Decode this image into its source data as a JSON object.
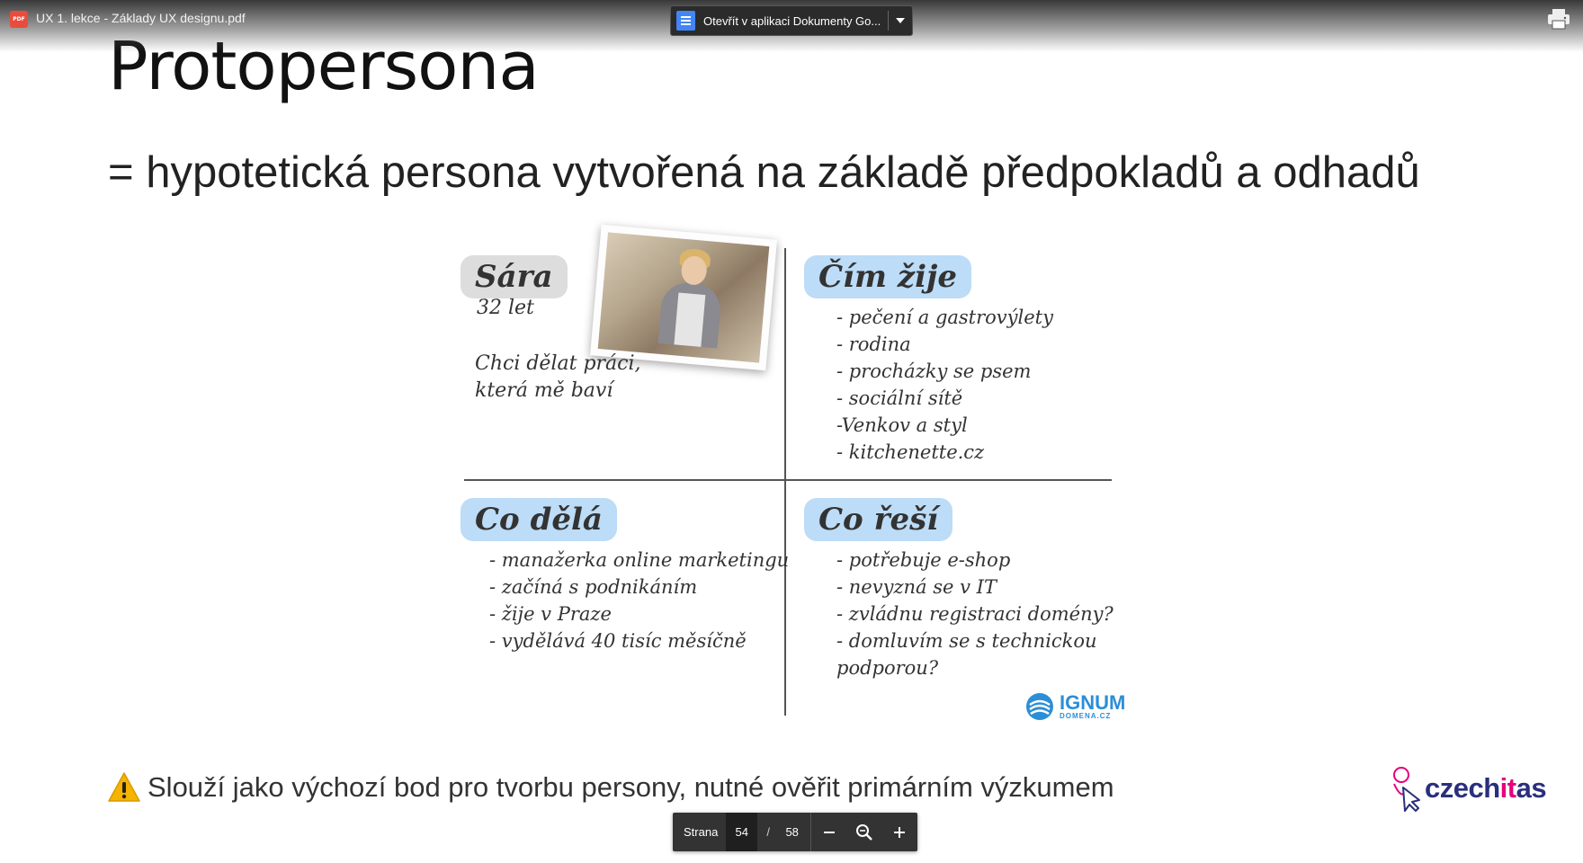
{
  "viewer": {
    "file_title": "UX 1. lekce - Základy UX designu.pdf",
    "file_badge": "PDF",
    "open_with_label": "Otevřít v aplikaci Dokumenty Go...",
    "page_label": "Strana",
    "page_current": "54",
    "page_separator": "/",
    "page_total": "58"
  },
  "slide": {
    "title": "Protopersona",
    "subtitle": "= hypotetická persona vytvořená na základě předpokladů a odhadů",
    "persona": {
      "name": "Sára",
      "age": "32 let",
      "quote_line1": "Chci dělat práci,",
      "quote_line2": "která mě baví",
      "lives_title": "Čím žije",
      "lives": [
        "- pečení a gastrovýlety",
        "- rodina",
        "- procházky se psem",
        "- sociální sítě",
        "-Venkov a styl",
        "- kitchenette.cz"
      ],
      "does_title": "Co dělá",
      "does": [
        "- manažerka online marketingu",
        "- začíná s podnikáním",
        "- žije v Praze",
        "- vydělává 40 tisíc měsíčně"
      ],
      "solves_title": "Co řeší",
      "solves": [
        "- potřebuje e-shop",
        "- nevyzná se v IT",
        "- zvládnu registraci domény?",
        "- domluvím se s technickou",
        "podporou?"
      ],
      "sponsor": "IGNUM",
      "sponsor_sub": "DOMENA.CZ"
    },
    "note": "Slouží jako výchozí bod pro tvorbu persony, nutné ověřit primárním výzkumem",
    "brand_part1": "czech",
    "brand_part2": "it",
    "brand_part3": "as"
  },
  "colors": {
    "tag_blue": "#bcdcf7",
    "tag_gray": "#dddddd",
    "brand_navy": "#2a2f7c",
    "brand_pink": "#e5007e"
  }
}
